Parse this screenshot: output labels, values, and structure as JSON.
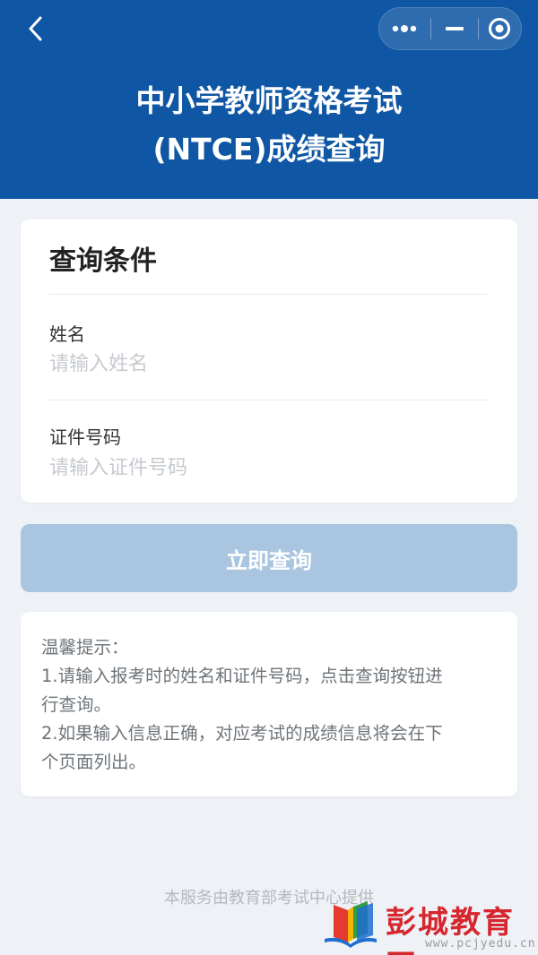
{
  "header": {
    "title_line1": "中小学教师资格考试",
    "title_line2": "(NTCE)成绩查询",
    "background_color": "#0f57a4"
  },
  "nav": {
    "back_icon": "chevron-left-icon",
    "more_icon": "more-dots-icon",
    "minimize_icon": "minimize-icon",
    "close_icon": "target-close-icon"
  },
  "form": {
    "card_title": "查询条件",
    "name": {
      "label": "姓名",
      "placeholder": "请输入姓名",
      "value": ""
    },
    "id_number": {
      "label": "证件号码",
      "placeholder": "请输入证件号码",
      "value": ""
    },
    "submit_label": "立即查询",
    "submit_color": "#a9c5df"
  },
  "tips": {
    "lines": [
      "温馨提示：",
      "1.请输入报考时的姓名和证件号码，点击查询按钮进",
      "行查询。",
      "2.如果输入信息正确，对应考试的成绩信息将会在下",
      "个页面列出。"
    ]
  },
  "footer": {
    "text": "本服务由教育部考试中心提供"
  },
  "watermark": {
    "brand": "彭城教育网",
    "url": "www.pcjyedu.cn",
    "brand_color": "#d6262e"
  }
}
